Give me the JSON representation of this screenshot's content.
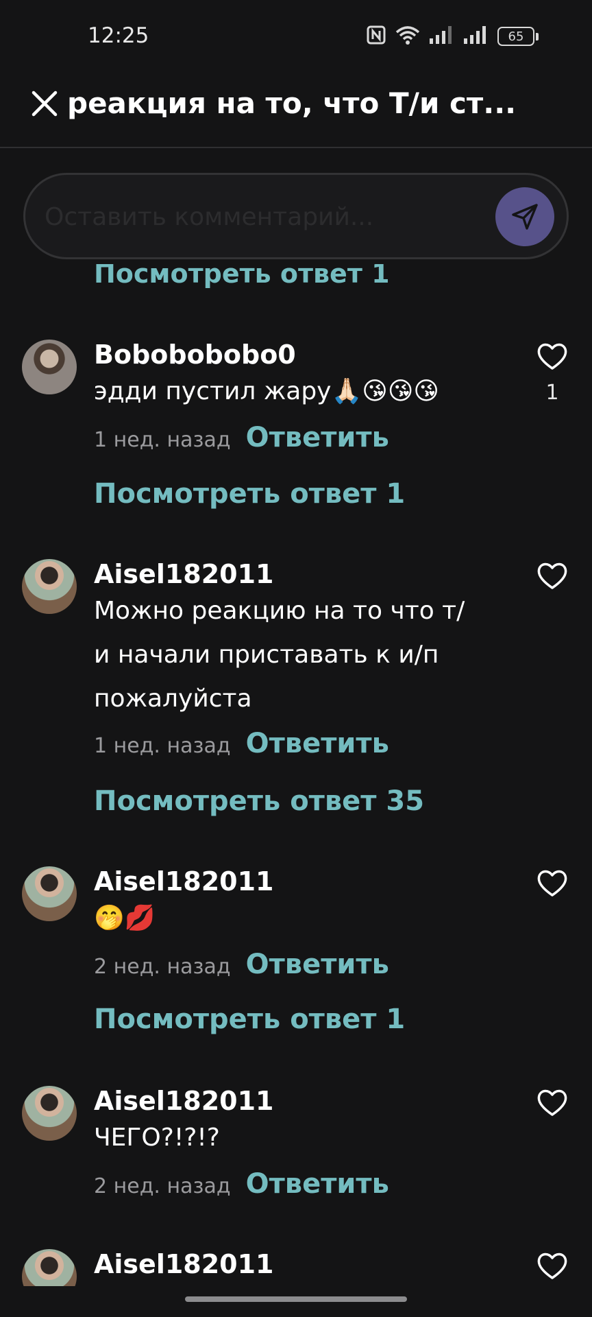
{
  "status_bar": {
    "time": "12:25",
    "battery": "65",
    "icons": [
      "nfc-icon",
      "wifi-icon",
      "signal-icon",
      "signal-icon",
      "battery-icon"
    ]
  },
  "header": {
    "title": "реакция на то, что Т/и ст...",
    "close_icon": "close-icon"
  },
  "comment_input": {
    "placeholder": "Оставить комментарий...",
    "value": "",
    "send_icon": "send-icon"
  },
  "colors": {
    "background": "#141415",
    "accent": "#74bcc0",
    "send_button": "#57528a",
    "muted": "#9b9b9e"
  },
  "list": {
    "partial_view_replies": "Посмотреть ответ 1",
    "comments": [
      {
        "username": "Bobobobobo0",
        "text": "эдди пустил жару🙏🏻😘😘😘",
        "time": "1 нед. назад",
        "reply_label": "Ответить",
        "likes": "1",
        "view_replies": "Посмотреть ответ 1"
      },
      {
        "username": "Aisel182011",
        "text_lines": [
          "Можно реакцию на то что т/",
          "и начали приставать к и/п",
          "пожалуйста"
        ],
        "time": "1 нед. назад",
        "reply_label": "Ответить",
        "likes": "",
        "view_replies": "Посмотреть ответ 35"
      },
      {
        "username": "Aisel182011",
        "text": "🤭💋",
        "time": "2 нед. назад",
        "reply_label": "Ответить",
        "likes": "",
        "view_replies": "Посмотреть ответ 1"
      },
      {
        "username": "Aisel182011",
        "text": "ЧЕГО?!?!?",
        "time": "2 нед. назад",
        "reply_label": "Ответить",
        "likes": ""
      },
      {
        "username": "Aisel182011"
      }
    ]
  }
}
